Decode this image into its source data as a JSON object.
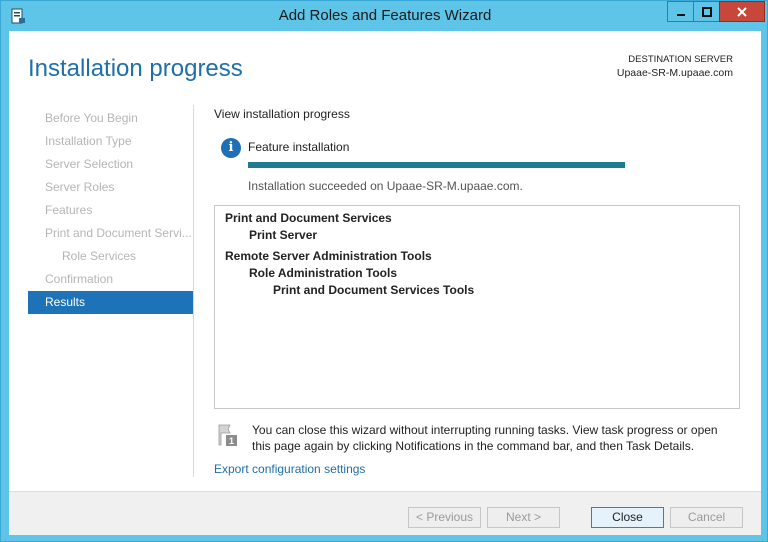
{
  "window": {
    "title": "Add Roles and Features Wizard"
  },
  "header": {
    "title": "Installation progress",
    "destination_label": "DESTINATION SERVER",
    "destination_server": "Upaae-SR-M.upaae.com"
  },
  "nav": {
    "items": [
      {
        "label": "Before You Begin",
        "state": "disabled"
      },
      {
        "label": "Installation Type",
        "state": "disabled"
      },
      {
        "label": "Server Selection",
        "state": "disabled"
      },
      {
        "label": "Server Roles",
        "state": "disabled"
      },
      {
        "label": "Features",
        "state": "disabled"
      },
      {
        "label": "Print and Document Servi...",
        "state": "disabled"
      },
      {
        "label": "Role Services",
        "state": "disabled",
        "sub": true
      },
      {
        "label": "Confirmation",
        "state": "disabled"
      },
      {
        "label": "Results",
        "state": "active"
      }
    ]
  },
  "main": {
    "view_label": "View installation progress",
    "feature_title": "Feature installation",
    "progress_percent": 100,
    "status_text": "Installation succeeded on Upaae-SR-M.upaae.com.",
    "results": [
      "Print and Document Services",
      "Print Server",
      "Remote Server Administration Tools",
      "Role Administration Tools",
      "Print and Document Services Tools"
    ],
    "note": "You can close this wizard without interrupting running tasks. View task progress or open this page again by clicking Notifications in the command bar, and then Task Details.",
    "export_link": "Export configuration settings"
  },
  "footer": {
    "previous_label": "< Previous",
    "next_label": "Next >",
    "close_label": "Close",
    "cancel_label": "Cancel"
  },
  "colors": {
    "accent": "#1d72b8",
    "frame": "#5ec4e8",
    "progress": "#1e7c8e",
    "close_button": "#c7483a"
  },
  "icons": {
    "app": "server-manager-icon",
    "info": "info-icon",
    "note": "flag-notification-icon"
  }
}
